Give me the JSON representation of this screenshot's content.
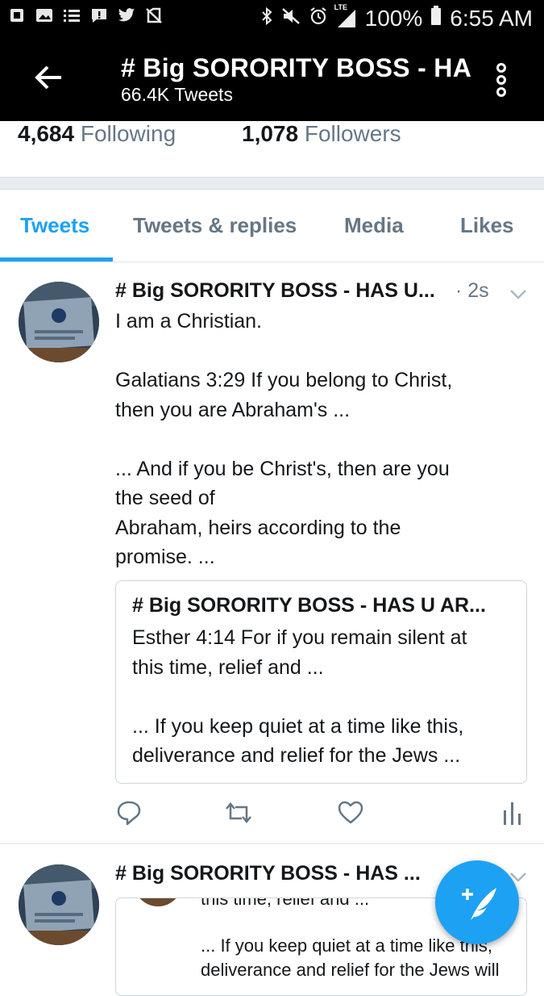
{
  "status_bar": {
    "battery": "100%",
    "time": "6:55 AM",
    "network": "LTE",
    "icons_left": [
      "stop-icon",
      "gallery-icon",
      "list-icon",
      "alert-icon",
      "twitter-icon",
      "no-sim-icon"
    ],
    "icons_right": [
      "bluetooth-icon",
      "mute-icon",
      "alarm-icon",
      "signal-icon",
      "battery-icon"
    ]
  },
  "header": {
    "title": "# Big SORORITY BOSS - HA",
    "subtitle": "66.4K Tweets"
  },
  "stats": {
    "following_count": "4,684",
    "following_label": "Following",
    "followers_count": "1,078",
    "followers_label": "Followers"
  },
  "tabs": [
    {
      "label": "Tweets",
      "active": true
    },
    {
      "label": "Tweets & replies",
      "active": false
    },
    {
      "label": "Media",
      "active": false
    },
    {
      "label": "Likes",
      "active": false
    }
  ],
  "tweets": [
    {
      "name": "# Big SORORITY BOSS - HAS U...",
      "time": "· 2s",
      "text": "I am a Christian.\n\nGalatians 3:29 If you belong to Christ,\nthen you are Abraham's ...\n\n... And if you be Christ's, then are you\nthe seed of\nAbraham, heirs according to the\npromise. ...",
      "quote": {
        "name": "# Big SORORITY BOSS - HAS U AR...",
        "text": "Esther 4:14 For if you remain silent at\nthis time, relief and ...\n\n... If you keep quiet at a time like this,\ndeliverance and relief for the Jews ..."
      }
    },
    {
      "name": "# Big SORORITY BOSS - HAS ...",
      "quote_partial": {
        "top_line": "this time, relief and ...",
        "text": "... If you keep quiet at a time like this,\ndeliverance and relief for the Jews will"
      }
    }
  ],
  "colors": {
    "accent": "#1da1f2",
    "header_bg": "#000000",
    "secondary_text": "#657786",
    "divider": "#e6ecf0"
  }
}
